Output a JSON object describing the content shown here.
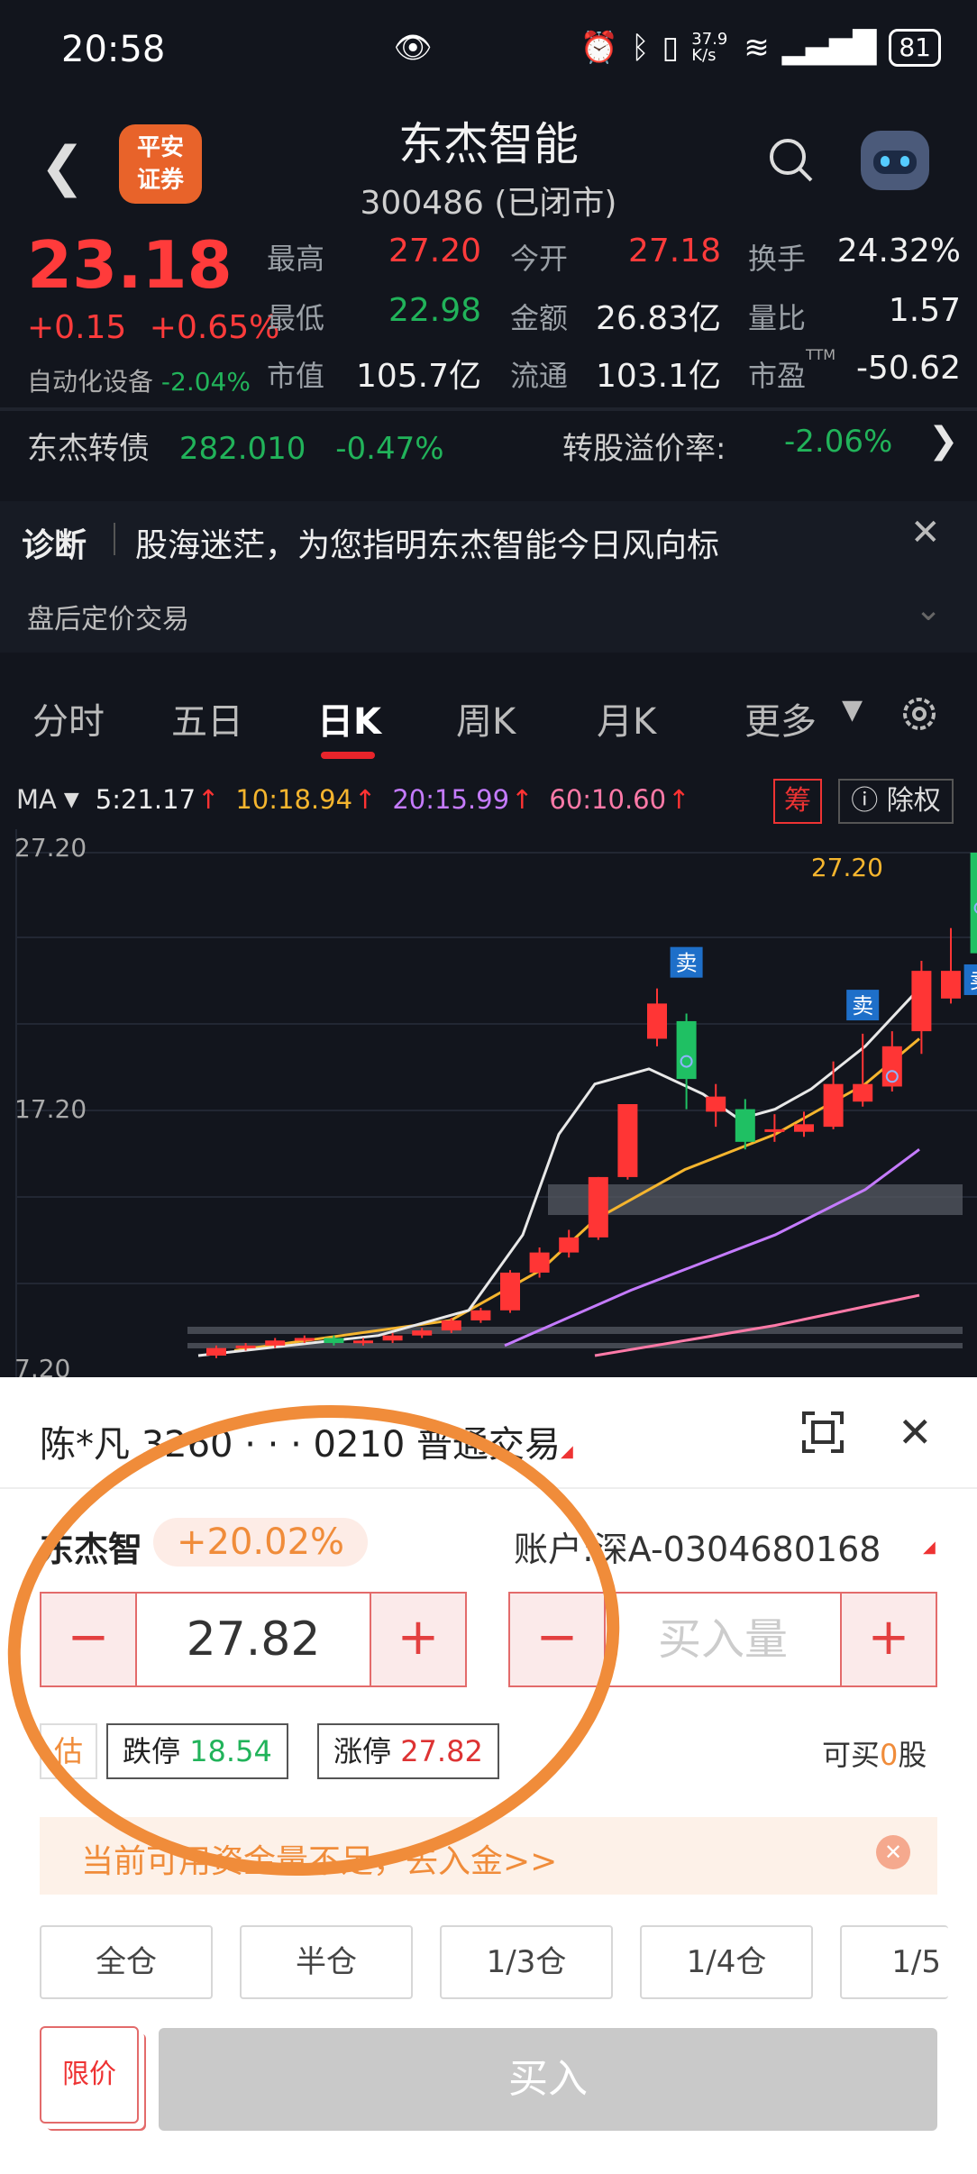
{
  "status_bar": {
    "time": "20:58",
    "net_speed": "37.9 K/s",
    "battery": "81"
  },
  "header": {
    "logo": "平安证券",
    "title": "东杰智能",
    "subtitle": "300486 (已闭市)"
  },
  "quote": {
    "price": "23.18",
    "change": "+0.15",
    "change_pct": "+0.65%",
    "sector_name": "自动化设备",
    "sector_pct": "-2.04%",
    "fields": [
      {
        "k": "最高",
        "v": "27.20",
        "c": "red"
      },
      {
        "k": "今开",
        "v": "27.18",
        "c": "red"
      },
      {
        "k": "换手",
        "v": "24.32%",
        "c": "white"
      },
      {
        "k": "最低",
        "v": "22.98",
        "c": "green"
      },
      {
        "k": "金额",
        "v": "26.83亿",
        "c": "white"
      },
      {
        "k": "量比",
        "v": "1.57",
        "c": "white"
      },
      {
        "k": "市值",
        "v": "105.7亿",
        "c": "white"
      },
      {
        "k": "流通",
        "v": "103.1亿",
        "c": "white"
      },
      {
        "k": "市盈",
        "v": "-50.62",
        "c": "white"
      }
    ],
    "ttm": "TTM"
  },
  "convert_bond": {
    "name": "东杰转债",
    "price": "282.010",
    "pct": "-0.47%",
    "premium_label": "转股溢价率:",
    "premium": "-2.06%"
  },
  "diagnosis": {
    "tag": "诊断",
    "text": "股海迷茫，为您指明东杰智能今日风向标",
    "after_hours": "盘后定价交易"
  },
  "tabs": [
    "分时",
    "五日",
    "日K",
    "周K",
    "月K",
    "更多"
  ],
  "ma": {
    "label": "MA",
    "ma5": "5:21.17",
    "ma10": "10:18.94",
    "ma20": "20:15.99",
    "ma60": "60:10.60",
    "chip": "筹",
    "fq": "除权"
  },
  "chart_data": {
    "type": "candlestick",
    "y_labels": [
      "27.20",
      "17.20",
      "7.20"
    ],
    "high_label": "27.20",
    "markers": [
      "卖",
      "卖",
      "卖"
    ],
    "candles": [
      {
        "o": 7.2,
        "c": 7.5,
        "h": 7.6,
        "l": 7.1
      },
      {
        "o": 7.5,
        "c": 7.6,
        "h": 7.7,
        "l": 7.4
      },
      {
        "o": 7.6,
        "c": 7.8,
        "h": 7.9,
        "l": 7.5
      },
      {
        "o": 7.8,
        "c": 7.9,
        "h": 8.0,
        "l": 7.7
      },
      {
        "o": 7.9,
        "c": 7.7,
        "h": 8.0,
        "l": 7.6
      },
      {
        "o": 7.7,
        "c": 7.8,
        "h": 7.9,
        "l": 7.6
      },
      {
        "o": 7.8,
        "c": 8.0,
        "h": 8.1,
        "l": 7.7
      },
      {
        "o": 8.0,
        "c": 8.2,
        "h": 8.3,
        "l": 7.9
      },
      {
        "o": 8.2,
        "c": 8.6,
        "h": 8.7,
        "l": 8.1
      },
      {
        "o": 8.6,
        "c": 9.0,
        "h": 9.1,
        "l": 8.5
      },
      {
        "o": 9.0,
        "c": 10.5,
        "h": 10.6,
        "l": 8.9
      },
      {
        "o": 10.5,
        "c": 11.3,
        "h": 11.5,
        "l": 10.3
      },
      {
        "o": 11.3,
        "c": 11.9,
        "h": 12.2,
        "l": 11.1
      },
      {
        "o": 11.9,
        "c": 14.3,
        "h": 14.3,
        "l": 11.8
      },
      {
        "o": 14.3,
        "c": 17.2,
        "h": 17.2,
        "l": 14.2
      },
      {
        "o": 19.8,
        "c": 21.2,
        "h": 21.8,
        "l": 19.5
      },
      {
        "o": 20.5,
        "c": 18.2,
        "h": 20.8,
        "l": 17.0
      },
      {
        "o": 16.9,
        "c": 17.5,
        "h": 18.0,
        "l": 16.3
      },
      {
        "o": 17.0,
        "c": 15.7,
        "h": 17.4,
        "l": 15.4
      },
      {
        "o": 16.1,
        "c": 16.2,
        "h": 16.8,
        "l": 15.7
      },
      {
        "o": 16.1,
        "c": 16.4,
        "h": 16.9,
        "l": 15.9
      },
      {
        "o": 16.3,
        "c": 18.0,
        "h": 18.9,
        "l": 16.2
      },
      {
        "o": 17.3,
        "c": 18.0,
        "h": 20.0,
        "l": 17.1
      },
      {
        "o": 17.9,
        "c": 19.5,
        "h": 20.1,
        "l": 17.7
      },
      {
        "o": 20.1,
        "c": 22.5,
        "h": 22.9,
        "l": 19.2
      },
      {
        "o": 21.4,
        "c": 22.5,
        "h": 24.2,
        "l": 21.2
      },
      {
        "o": 27.2,
        "c": 23.2,
        "h": 27.2,
        "l": 22.9
      }
    ],
    "ylim": [
      7.2,
      27.2
    ]
  },
  "order": {
    "account_title": "陈*凡 3260 · · · 0210 普通交易",
    "stock_short": "东杰智",
    "limit_pct": "+20.02%",
    "account_label": "账户:深A-0304680168",
    "price_value": "27.82",
    "qty_placeholder": "买入量",
    "est": "估",
    "limit_down_label": "跌停",
    "limit_down": "18.54",
    "limit_up_label": "涨停",
    "limit_up": "27.82",
    "can_buy_pre": "可买",
    "can_buy_num": "0",
    "can_buy_post": "股",
    "notice": "当前可用资金量不足，去入金>>",
    "positions": [
      "全仓",
      "半仓",
      "1/3仓",
      "1/4仓",
      "1/5"
    ],
    "order_type": "限价",
    "buy_button": "买入"
  }
}
